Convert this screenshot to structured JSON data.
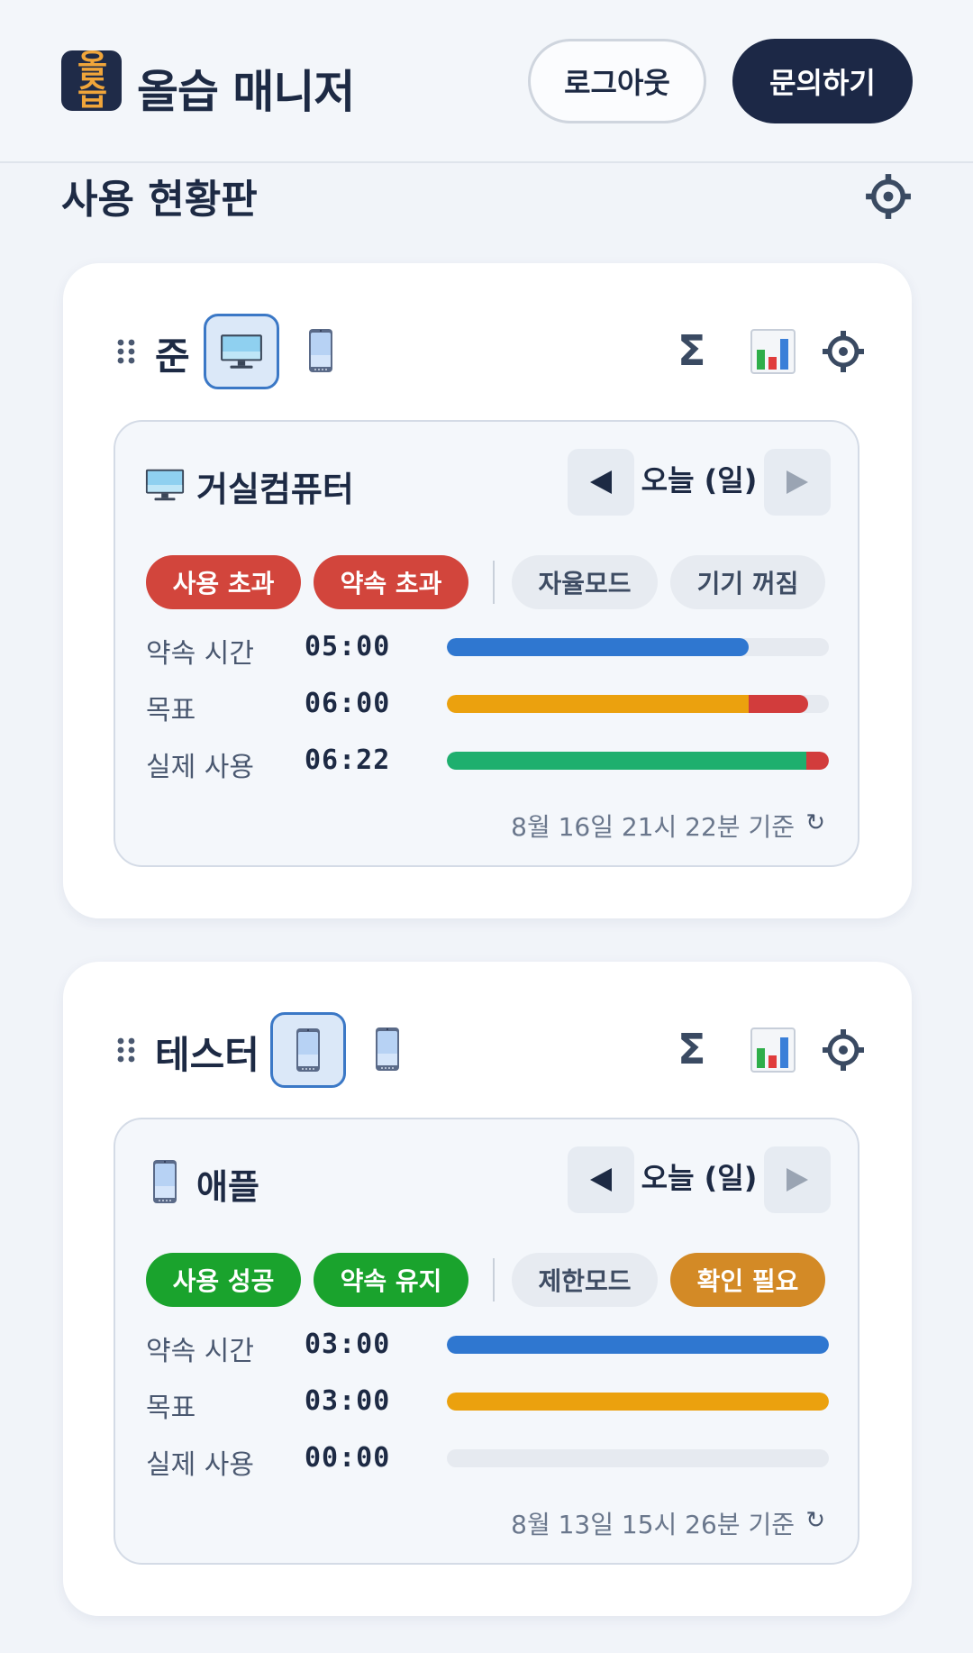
{
  "header": {
    "logo_top": "올",
    "logo_bottom": "습",
    "app_title": "올습 매니저",
    "logout_label": "로그아웃",
    "contact_label": "문의하기"
  },
  "page": {
    "title": "사용 현황판"
  },
  "colors": {
    "promise": "#2f77d0",
    "goal": "#eba10e",
    "actual": "#1eaf6e",
    "over": "#d23c3c",
    "empty": "#e6eaf0"
  },
  "icons": [
    "drag-handle-icon",
    "monitor-icon",
    "phone-icon",
    "sigma-icon",
    "bar-chart-icon",
    "gear-icon",
    "chevron-left-icon",
    "chevron-right-icon",
    "refresh-icon"
  ],
  "cards": [
    {
      "user": "준",
      "selected_device": "monitor",
      "device_name": "거실컴퓨터",
      "date_label": "오늘 (일)",
      "badges": [
        "사용 초과",
        "약속 초과",
        "자율모드",
        "기기 꺼짐"
      ],
      "rows": [
        {
          "label": "약속 시간",
          "value": "05:00",
          "fraction": 0.79,
          "over_fraction": 0
        },
        {
          "label": "목표",
          "value": "06:00",
          "fraction": 0.79,
          "over_fraction": 0.155
        },
        {
          "label": "실제 사용",
          "value": "06:22",
          "fraction": 0.94,
          "over_fraction": 0.06
        }
      ],
      "updated": "8월 16일 21시 22분 기준",
      "refresh": "↻"
    },
    {
      "user": "테스터",
      "selected_device": "phone",
      "device_name": "애플",
      "date_label": "오늘 (일)",
      "badges": [
        "사용 성공",
        "약속 유지",
        "제한모드",
        "확인 필요"
      ],
      "rows": [
        {
          "label": "약속 시간",
          "value": "03:00",
          "fraction": 1.0,
          "over_fraction": 0
        },
        {
          "label": "목표",
          "value": "03:00",
          "fraction": 1.0,
          "over_fraction": 0
        },
        {
          "label": "실제 사용",
          "value": "00:00",
          "fraction": 0,
          "over_fraction": 0
        }
      ],
      "updated": "8월 13일 15시 26분 기준",
      "refresh": "↻"
    }
  ]
}
